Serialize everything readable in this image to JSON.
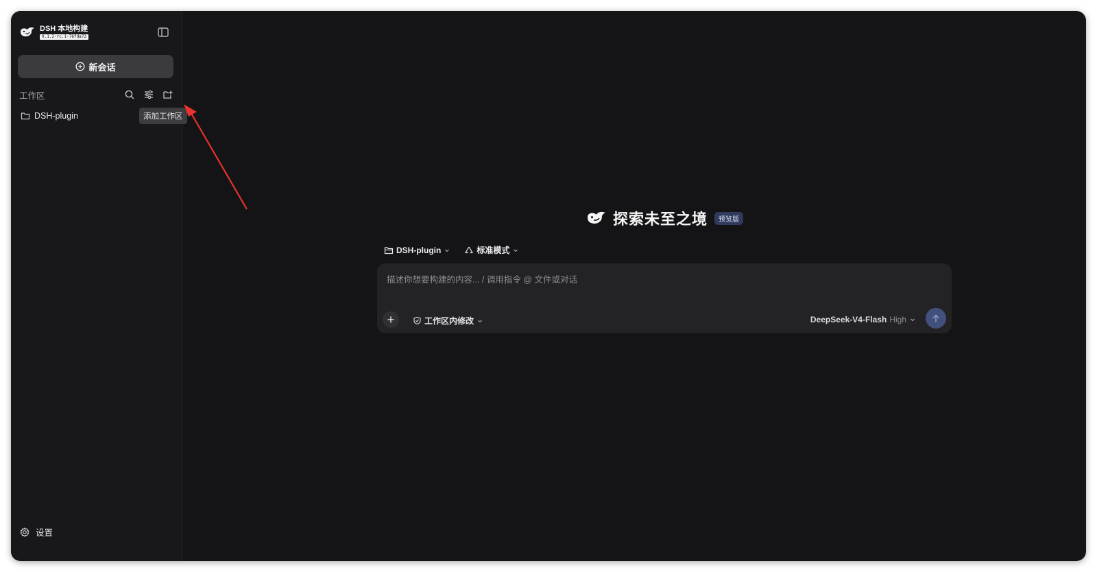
{
  "sidebar": {
    "brand_name": "DSH 本地构建",
    "brand_version": "0.1.2-rc.1-76fda72",
    "new_chat_label": "新会话",
    "workspace_title": "工作区",
    "workspaces": [
      {
        "label": "DSH-plugin"
      }
    ],
    "tooltip": "添加工作区",
    "settings_label": "设置"
  },
  "main": {
    "hero_title": "探索未至之境",
    "hero_badge": "预览版",
    "workspace_selector": "DSH-plugin",
    "mode_selector": "标准模式",
    "composer": {
      "placeholder": "描述你想要构建的内容... / 调用指令 @ 文件或对话",
      "permission_label": "工作区内修改",
      "model_name": "DeepSeek-V4-Flash",
      "model_level": "High"
    }
  },
  "icons": {
    "logo": "whale-logo-icon",
    "collapse": "sidebar-toggle-icon",
    "new_chat": "plus-circle-icon",
    "search": "search-icon",
    "filter": "sliders-icon",
    "add_workspace": "folder-plus-icon",
    "folder": "folder-icon",
    "settings": "gear-icon",
    "attach": "plus-icon",
    "permission": "shield-icon",
    "mode": "recycle-icon",
    "send": "arrow-up-icon",
    "chevron": "chevron-down-icon"
  },
  "colors": {
    "window_bg": "#141416",
    "sidebar_bg": "#18181b",
    "accent": "#42507e",
    "annotation": "#e8322b"
  }
}
